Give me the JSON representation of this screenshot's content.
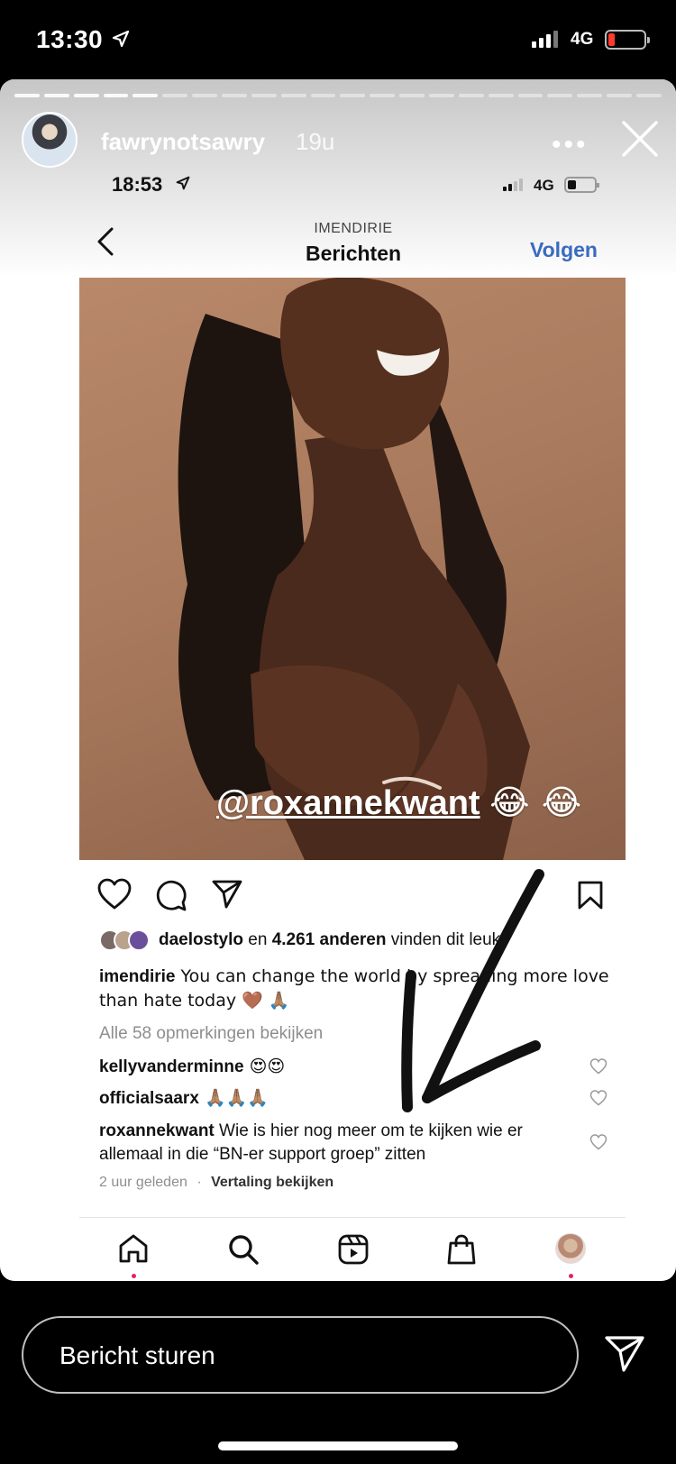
{
  "status_bar": {
    "time": "13:30",
    "network": "4G"
  },
  "story": {
    "username": "fawrynotsawry",
    "age": "19u",
    "more_label": "•••"
  },
  "inner_screenshot": {
    "status": {
      "time": "18:53",
      "network": "4G"
    },
    "owner": "IMENDIRIE",
    "title": "Berichten",
    "follow": "Volgen",
    "mention": "@roxannekwant",
    "mention_emoji": "😂 😂",
    "likes": {
      "user": "daelostylo",
      "text_mid": " en ",
      "count": "4.261 anderen",
      "text_end": " vinden dit leuk"
    },
    "caption": {
      "user": "imendirie",
      "text": " You can change the world by spreading more love than hate today 🤎 🙏🏽"
    },
    "view_all_comments": "Alle 58 opmerkingen bekijken",
    "comments": [
      {
        "user": "kellyvanderminne",
        "text": " 😍😍"
      },
      {
        "user": "officialsaarx",
        "text": " 🙏🏽🙏🏽🙏🏽"
      },
      {
        "user": "roxannekwant",
        "text": " Wie is hier nog meer om te kijken wie er allemaal in die “BN-er support groep” zitten"
      }
    ],
    "meta": {
      "time": "2 uur geleden",
      "separator": "·",
      "translate": "Vertaling bekijken"
    }
  },
  "reply": {
    "placeholder": "Bericht sturen"
  },
  "colors": {
    "follow": "#3a6bc0",
    "link_gray": "#8e8e8e",
    "notification_dot": "#e0245e"
  }
}
